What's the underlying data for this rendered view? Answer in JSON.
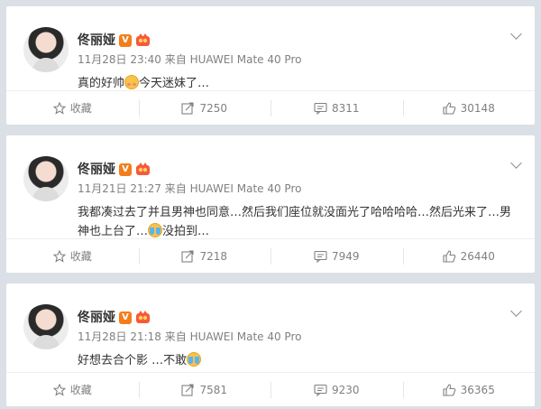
{
  "posts": [
    {
      "author": "佟丽娅",
      "vip_badge": "V",
      "time": "11月28日 23:40",
      "source": "来自 HUAWEI Mate 40 Pro",
      "text_a": "真的好帅",
      "emoji_a": "shy-emoji",
      "text_b": "今天迷妹了…",
      "emoji_b": "",
      "text_c": "",
      "favorite_label": "收藏",
      "reposts": "7250",
      "comments": "8311",
      "likes": "30148"
    },
    {
      "author": "佟丽娅",
      "vip_badge": "V",
      "time": "11月21日 21:27",
      "source": "来自 HUAWEI Mate 40 Pro",
      "text_a": "我都凑过去了并且男神也同意…然后我们座位就没面光了哈哈哈哈…然后光来了…男神也上台了…",
      "emoji_a": "cry-emoji",
      "text_b": "没拍到…",
      "favorite_label": "收藏",
      "reposts": "7218",
      "comments": "7949",
      "likes": "26440"
    },
    {
      "author": "佟丽娅",
      "vip_badge": "V",
      "time": "11月28日 21:18",
      "source": "来自 HUAWEI Mate 40 Pro",
      "text_a": "好想去合个影 …不敢",
      "emoji_a": "cry-emoji",
      "text_b": "",
      "favorite_label": "收藏",
      "reposts": "7581",
      "comments": "9230",
      "likes": "36365"
    }
  ],
  "colors": {
    "vip": "#f37d1c",
    "meta": "#808080",
    "text": "#333333"
  }
}
